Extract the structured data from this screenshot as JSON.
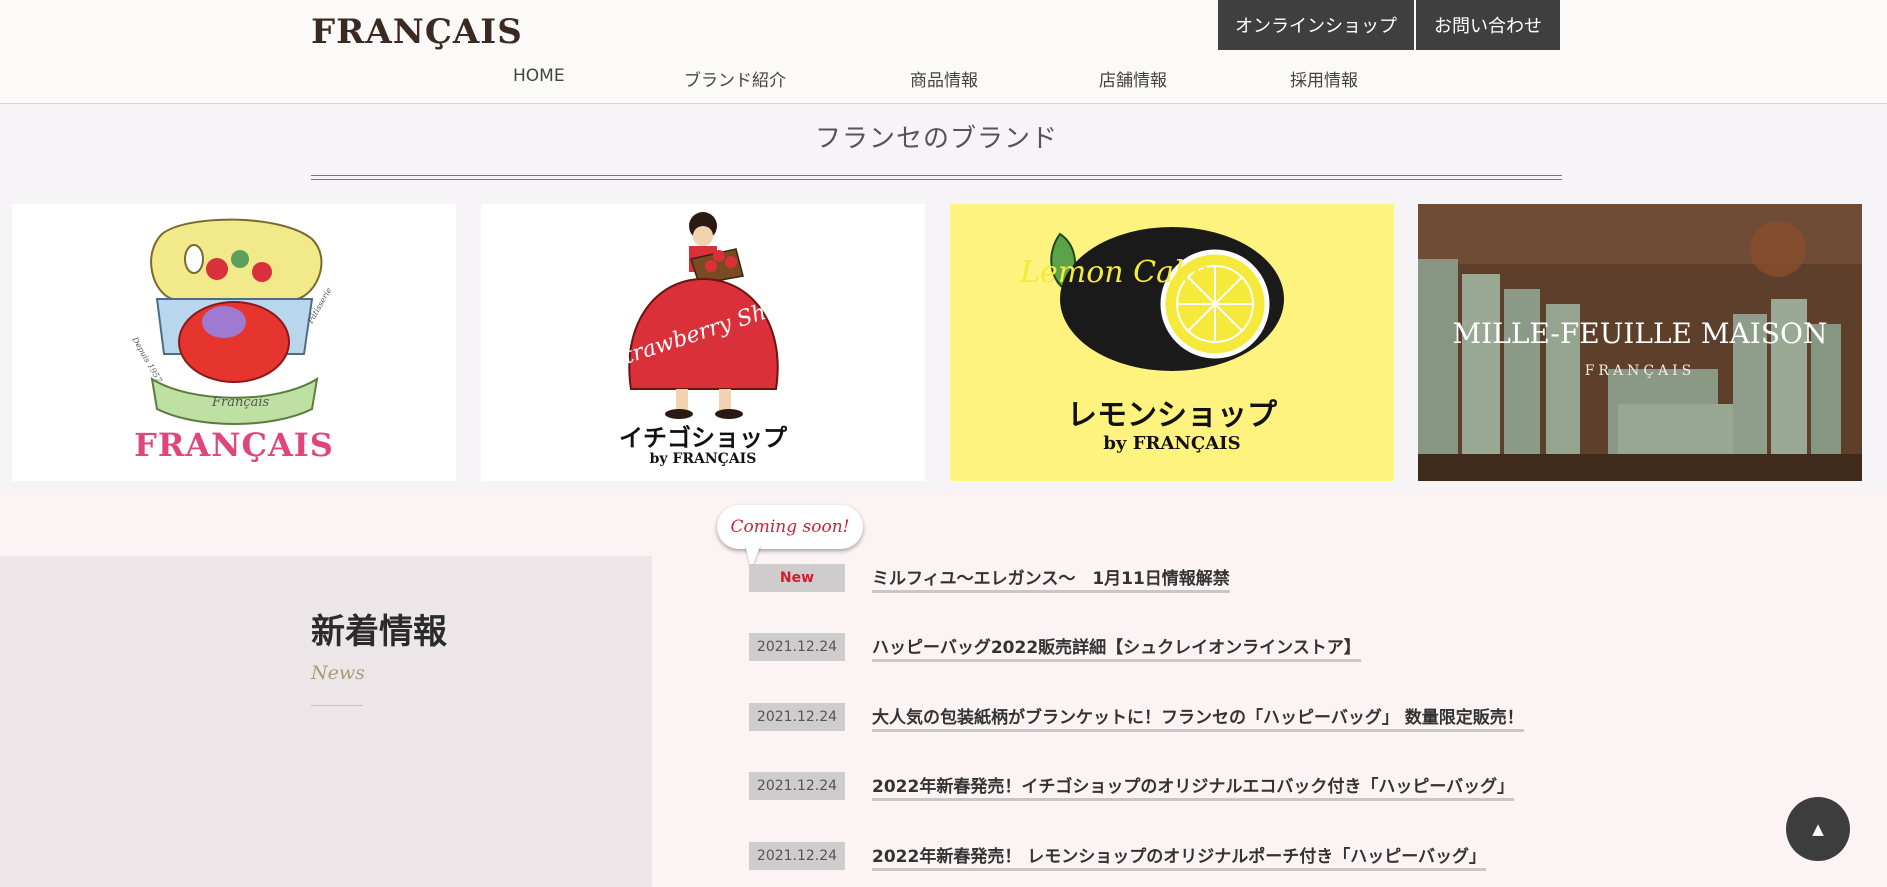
{
  "header": {
    "logo": "FRANÇAIS",
    "buttons": {
      "shop": "オンラインショップ",
      "contact": "お問い合わせ"
    },
    "nav": [
      "HOME",
      "ブランド紹介",
      "商品情報",
      "店舗情報",
      "採用情報"
    ]
  },
  "brands": {
    "title": "フランセのブランド",
    "cards": [
      {
        "logo_text": "FRANÇAIS",
        "script_text": "Français",
        "badge_left": "Depuis 1957",
        "badge_right": "Pâtisserie"
      },
      {
        "name": "イチゴショップ",
        "by": "by FRANÇAIS",
        "script_text": "Strawberry Shop"
      },
      {
        "name": "レモンショップ",
        "by": "by FRANÇAIS",
        "script_text": "Lemon Cake"
      },
      {
        "name": "MILLE-FEUILLE MAISON",
        "sub": "FRANÇAIS"
      }
    ]
  },
  "news": {
    "heading": "新着情報",
    "subheading": "News",
    "coming_soon": "Coming soon!",
    "items": [
      {
        "date": "New",
        "title": "ミルフィユ～エレガンス～　1月11日情報解禁"
      },
      {
        "date": "2021.12.24",
        "title": "ハッピーバッグ2022販売詳細【シュクレイオンラインストア】"
      },
      {
        "date": "2021.12.24",
        "title": "大人気の包装紙柄がブランケットに！フランセの「ハッピーバッグ」 数量限定販売！"
      },
      {
        "date": "2021.12.24",
        "title": "2022年新春発売！イチゴショップのオリジナルエコバック付き「ハッピーバッグ」"
      },
      {
        "date": "2021.12.24",
        "title": "2022年新春発売！ レモンショップのオリジナルポーチ付き「ハッピーバッグ」"
      }
    ]
  },
  "page_top": "▲",
  "colors": {
    "accent_red": "#d11d2f",
    "dark_button": "#3f3f3f",
    "lemon_bg": "#fdf37e",
    "strawberry_red": "#d9303a",
    "pink": "#e0457b"
  }
}
